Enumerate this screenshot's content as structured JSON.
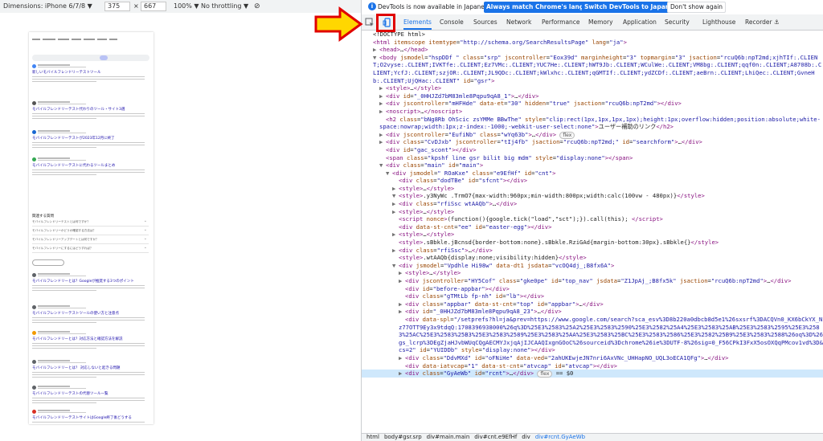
{
  "device_toolbar": {
    "dimensions_label": "Dimensions: iPhone 6/7/8 ▼",
    "width": "375",
    "times": "×",
    "height": "667",
    "zoom": "100% ▼",
    "throttle": "No throttling ▼"
  },
  "banner": {
    "message": "DevTools is now available in Japanese!",
    "match_button": "Always match Chrome's language",
    "switch_button": "Switch DevTools to Japanese",
    "dismiss_button": "Don't show again"
  },
  "tabs": [
    "Elements",
    "Console",
    "Sources",
    "Network",
    "Performance",
    "Memory",
    "Application",
    "Security",
    "Lighthouse",
    "Recorder ⚓"
  ],
  "phone": {
    "results": [
      {
        "title": "新しいモバイルフレンドリーテストツール",
        "fav": "#4285f4"
      },
      {
        "title": "モバイルフレンドリーテスト代わりのツール・サイト3選",
        "fav": "#555555"
      },
      {
        "title": "モバイルフレンドリーテストが2023年12月に終了",
        "fav": "#1967d2"
      },
      {
        "title": "モバイルフレンドリーテストに代わるツールまとめ",
        "fav": "#34a853"
      }
    ],
    "faq_heading": "関連する質問",
    "faq": [
      "モバイルフレンドリーテストとは何ですか？",
      "モバイルフレンドリーかどうか確認する方法は？",
      "モバイルフレンドリーアップデートとは何ですか？",
      "モバイルフレンドリーにするにはどうすれば？"
    ],
    "results2": [
      {
        "title": "モバイルフレンドリーとは？Googleが推奨する3つのポイント",
        "fav": "#5f6368"
      },
      {
        "title": "モバイルフレンドリーテストツールの使い方と注意点",
        "fav": "#5f6368"
      },
      {
        "title": "モバイルフレンドリーとは？対応方法と確認方法を解説",
        "fav": "#f29900"
      },
      {
        "title": "モバイルフレンドリーとは？ 対応しないと起きる問題",
        "fav": "#5f6368"
      },
      {
        "title": "モバイルフレンドリーテストの代替ツール一覧",
        "fav": "#5f6368"
      },
      {
        "title": "モバイルフレンドリーテストサイトはGoogle終了後どうする",
        "fav": "#d93025"
      }
    ]
  },
  "breadcrumbs": [
    "html",
    "body#gsr.srp",
    "div#main.main",
    "div#cnt.e9EfHf",
    "div",
    "div#rcnt.GyAeWb"
  ],
  "dom_lines": [
    {
      "indent": 0,
      "html": "<span class=\"tx\">&lt;!DOCTYPE html&gt;</span>"
    },
    {
      "indent": 0,
      "html": "<span class=\"tg\">&lt;html</span> <span class=\"at\">itemscope</span> <span class=\"at\">itemtype</span>=<span class=\"av\">\"http://schema.org/SearchResultsPage\"</span> <span class=\"at\">lang</span>=<span class=\"av\">\"ja\"</span><span class=\"tg\">&gt;</span>"
    },
    {
      "indent": 1,
      "tw": "▶",
      "html": "<span class=\"tg\">&lt;head&gt;</span>…<span class=\"tg\">&lt;/head&gt;</span>"
    },
    {
      "indent": 1,
      "tw": "▼",
      "wrap": true,
      "html": "<span class=\"tg\">&lt;body</span> <span class=\"at\">jsmodel</span>=<span class=\"av\">\"hspDDf \"</span> <span class=\"at\">class</span>=<span class=\"av\">\"srp\"</span> <span class=\"at\">jscontroller</span>=<span class=\"av\">\"Eox39d\"</span> <span class=\"at\">marginheight</span>=<span class=\"av\">\"3\"</span> <span class=\"at\">topmargin</span>=<span class=\"av\">\"3\"</span> <span class=\"at\">jsaction</span>=<span class=\"av\">\"rcuQ6b:npT2md;xjhTIf:.CLIENT;O2vyse:.CLIENT;IVKTfe:.CLIENT;Ez7VMc:.CLIENT;YUC7He:.CLIENT;hWT9Jb:.CLIENT;WCulWe:.CLIENT;VM8bg:.CLIENT;qqf0n:.CLIENT;A8708b:.CLIENT;YcfJ:.CLIENT;szjOR:.CLIENT;JL9QDc:.CLIENT;kWlxhc:.CLIENT;qGMTIf:.CLIENT;ydZCDf:.CLIENT;aeBrn:.CLIENT;LhiQec:.CLIENT;GvneHb:.CLIENT;UjQHac:.CLIENT\"</span> <span class=\"at\">id</span>=<span class=\"av\">\"gsr\"</span><span class=\"tg\">&gt;</span>"
    },
    {
      "indent": 2,
      "tw": "▶",
      "html": "<span class=\"tg\">&lt;style&gt;</span>…<span class=\"tg\">&lt;/style&gt;</span>"
    },
    {
      "indent": 2,
      "tw": "▶",
      "html": "<span class=\"tg\">&lt;div</span> <span class=\"at\">id</span>=<span class=\"av\">\"_0HHJZd7bM83mle8Pqpu9qA8_1\"</span><span class=\"tg\">&gt;</span>…<span class=\"tg\">&lt;/div&gt;</span>"
    },
    {
      "indent": 2,
      "tw": "▶",
      "html": "<span class=\"tg\">&lt;div</span> <span class=\"at\">jscontroller</span>=<span class=\"av\">\"mHFHde\"</span> <span class=\"at\">data-et</span>=<span class=\"av\">\"30\"</span> <span class=\"at\">hidden</span>=<span class=\"av\">\"true\"</span> <span class=\"at\">jsaction</span>=<span class=\"av\">\"rcuQ6b:npT2md\"</span><span class=\"tg\">&gt;&lt;/div&gt;</span>"
    },
    {
      "indent": 2,
      "tw": "▶",
      "html": "<span class=\"tg\">&lt;noscript&gt;</span>…<span class=\"tg\">&lt;/noscript&gt;</span>"
    },
    {
      "indent": 2,
      "wrap": true,
      "html": "<span class=\"tg\">&lt;h2</span> <span class=\"at\">class</span>=<span class=\"av\">\"bNg8Rb OhScic zsYMMe BBwThe\"</span> <span class=\"at\">style</span>=<span class=\"av\">\"clip:rect(1px,1px,1px,1px);height:1px;overflow:hidden;position:absolute;white-space:nowrap;width:1px;z-index:-1000;-webkit-user-select:none\"</span><span class=\"tg\">&gt;</span>ユーザー補助のリンク<span class=\"tg\">&lt;/h2&gt;</span>"
    },
    {
      "indent": 2,
      "tw": "▶",
      "html": "<span class=\"tg\">&lt;div</span> <span class=\"at\">jscontroller</span>=<span class=\"av\">\"EufiNb\"</span> <span class=\"at\">class</span>=<span class=\"av\">\"wYq63b\"</span><span class=\"tg\">&gt;</span>…<span class=\"tg\">&lt;/div&gt;</span> <span class=\"badge\">flex</span>"
    },
    {
      "indent": 2,
      "tw": "▶",
      "html": "<span class=\"tg\">&lt;div</span> <span class=\"at\">class</span>=<span class=\"av\">\"CvDJxb\"</span> <span class=\"at\">jscontroller</span>=<span class=\"av\">\"tIj4fb\"</span> <span class=\"at\">jsaction</span>=<span class=\"av\">\"rcuQ6b:npT2md;\"</span> <span class=\"at\">id</span>=<span class=\"av\">\"searchform\"</span><span class=\"tg\">&gt;</span>…<span class=\"tg\">&lt;/div&gt;</span>"
    },
    {
      "indent": 2,
      "html": "<span class=\"tg\">&lt;div</span> <span class=\"at\">id</span>=<span class=\"av\">\"gac_scont\"</span><span class=\"tg\">&gt;&lt;/div&gt;</span>"
    },
    {
      "indent": 2,
      "html": "<span class=\"tg\">&lt;span</span> <span class=\"at\">class</span>=<span class=\"av\">\"kpshf line gsr bilit big mdm\"</span> <span class=\"at\">style</span>=<span class=\"av\">\"display:none\"</span><span class=\"tg\">&gt;&lt;/span&gt;</span>"
    },
    {
      "indent": 2,
      "tw": "▼",
      "html": "<span class=\"tg\">&lt;div</span> <span class=\"at\">class</span>=<span class=\"av\">\"main\"</span> <span class=\"at\">id</span>=<span class=\"av\">\"main\"</span><span class=\"tg\">&gt;</span>"
    },
    {
      "indent": 3,
      "tw": "▼",
      "html": "<span class=\"tg\">&lt;div</span> <span class=\"at\">jsmodel</span>=<span class=\"av\">\" ROaKxe\"</span> <span class=\"at\">class</span>=<span class=\"av\">\"e9EfHf\"</span> <span class=\"at\">id</span>=<span class=\"av\">\"cnt\"</span><span class=\"tg\">&gt;</span>"
    },
    {
      "indent": 4,
      "html": "<span class=\"tg\">&lt;div</span> <span class=\"at\">class</span>=<span class=\"av\">\"dodTBe\"</span> <span class=\"at\">id</span>=<span class=\"av\">\"sfcnt\"</span><span class=\"tg\">&gt;&lt;/div&gt;</span>"
    },
    {
      "indent": 4,
      "tw": "▶",
      "html": "<span class=\"tg\">&lt;style&gt;</span>…<span class=\"tg\">&lt;/style&gt;</span>"
    },
    {
      "indent": 4,
      "tw": "▼",
      "html": "<span class=\"tg\">&lt;style&gt;</span>.y3NyWc .TrmO7{max-width:960px;min-width:800px;width:calc(100vw - 480px)}<span class=\"tg\">&lt;/style&gt;</span>"
    },
    {
      "indent": 4,
      "tw": "▶",
      "html": "<span class=\"tg\">&lt;div</span> <span class=\"at\">class</span>=<span class=\"av\">\"rfiSsc wtAAQb\"</span><span class=\"tg\">&gt;</span>…<span class=\"tg\">&lt;/div&gt;</span>"
    },
    {
      "indent": 4,
      "tw": "▶",
      "html": "<span class=\"tg\">&lt;style&gt;</span>…<span class=\"tg\">&lt;/style&gt;</span>"
    },
    {
      "indent": 4,
      "html": "<span class=\"tg\">&lt;script</span> <span class=\"at\">nonce</span><span class=\"tg\">&gt;</span>(function(){google.tick(\"load\",\"sct\");}).call(this); <span class=\"tg\">&lt;/script&gt;</span>"
    },
    {
      "indent": 4,
      "html": "<span class=\"tg\">&lt;div</span> <span class=\"at\">data-st-cnt</span>=<span class=\"av\">\"ee\"</span> <span class=\"at\">id</span>=<span class=\"av\">\"easter-egg\"</span><span class=\"tg\">&gt;&lt;/div&gt;</span>"
    },
    {
      "indent": 4,
      "tw": "▶",
      "html": "<span class=\"tg\">&lt;style&gt;</span>…<span class=\"tg\">&lt;/style&gt;</span>"
    },
    {
      "indent": 4,
      "html": "<span class=\"tg\">&lt;style&gt;</span>.sBbkle.jBcnsd{border-bottom:none}.sBbkle.RziGAd{margin-bottom:30px}.sBbkle{}<span class=\"tg\">&lt;/style&gt;</span>"
    },
    {
      "indent": 4,
      "tw": "▶",
      "html": "<span class=\"tg\">&lt;div</span> <span class=\"at\">class</span>=<span class=\"av\">\"rfiSsc\"</span><span class=\"tg\">&gt;</span>…<span class=\"tg\">&lt;/div&gt;</span>"
    },
    {
      "indent": 4,
      "html": "<span class=\"tg\">&lt;style&gt;</span>.wtAAQb{display:none;visibility:hidden}<span class=\"tg\">&lt;/style&gt;</span>"
    },
    {
      "indent": 4,
      "tw": "▼",
      "html": "<span class=\"tg\">&lt;div</span> <span class=\"at\">jsmodel</span>=<span class=\"av\">\"Vpdhle Hi98w\"</span> <span class=\"at\">data-dt1</span> <span class=\"at\">jsdata</span>=<span class=\"av\">\"vcOQ4dj_;B8fx6A\"</span><span class=\"tg\">&gt;</span>"
    },
    {
      "indent": 5,
      "tw": "▶",
      "html": "<span class=\"tg\">&lt;style&gt;</span>…<span class=\"tg\">&lt;/style&gt;</span>"
    },
    {
      "indent": 5,
      "tw": "▶",
      "html": "<span class=\"tg\">&lt;div</span> <span class=\"at\">jscontroller</span>=<span class=\"av\">\"HY5Cof\"</span> <span class=\"at\">class</span>=<span class=\"av\">\"gke0pe\"</span> <span class=\"at\">id</span>=<span class=\"av\">\"top_nav\"</span> <span class=\"at\">jsdata</span>=<span class=\"av\">\"Z1JpAj_;B8fx5k\"</span> <span class=\"at\">jsaction</span>=<span class=\"av\">\"rcuQ6b:npT2md\"</span><span class=\"tg\">&gt;</span>…<span class=\"tg\">&lt;/div&gt;</span>"
    },
    {
      "indent": 5,
      "html": "<span class=\"tg\">&lt;div</span> <span class=\"at\">id</span>=<span class=\"av\">\"before-appbar\"</span><span class=\"tg\">&gt;&lt;/div&gt;</span>"
    },
    {
      "indent": 5,
      "html": "<span class=\"tg\">&lt;div</span> <span class=\"at\">class</span>=<span class=\"av\">\"gTMtLb fp-nh\"</span> <span class=\"at\">id</span>=<span class=\"av\">\"lb\"</span><span class=\"tg\">&gt;&lt;/div&gt;</span>"
    },
    {
      "indent": 5,
      "tw": "▶",
      "html": "<span class=\"tg\">&lt;div</span> <span class=\"at\">class</span>=<span class=\"av\">\"appbar\"</span> <span class=\"at\">data-st-cnt</span>=<span class=\"av\">\"top\"</span> <span class=\"at\">id</span>=<span class=\"av\">\"appbar\"</span><span class=\"tg\">&gt;</span>…<span class=\"tg\">&lt;/div&gt;</span>"
    },
    {
      "indent": 5,
      "tw": "▶",
      "html": "<span class=\"tg\">&lt;div</span> <span class=\"at\">id</span>=<span class=\"av\">\"_0HHJZd7bM83mle8Pqpu9qA8_23\"</span><span class=\"tg\">&gt;</span>…<span class=\"tg\">&lt;/div&gt;</span>"
    },
    {
      "indent": 5,
      "wrap": true,
      "html": "<span class=\"tg\">&lt;div</span> <span class=\"at\">data-spl</span>=<span class=\"av\">\"/setprefs?hl=ja&amp;prev=https://www.google.com/search?sca_esv%3D8b220a0dbcb8d5e1%26sxsrf%3DACQVn0_KX6bCkYX_Nz77OTT9Ey3x9tdqQ:1708396938000%26q%3D%25E3%2583%25A2%25E3%2583%2590%25E3%2582%25A4%25E3%2583%25AB%25E3%2583%2595%25E3%2583%25AC%25E3%2583%25B3%25E3%2583%2589%25E3%2583%25AA%25E3%2583%25BC%25E3%2583%2586%25E3%2582%25B9%25E3%2583%2588%26oq%3D%26gs_lcrp%3DEgZjaHJvbWUqCQgAECMYJxjqAjIJCAAQIxgnGOoC%26sourceid%3Dchrome%26ie%3DUTF-8%26sig=0_F56CPkI3FxX5osOXQqPMcov1vd%3D&amp;cs=2\"</span> <span class=\"at\">id</span>=<span class=\"av\">\"YUIDDb\"</span> <span class=\"at\">style</span>=<span class=\"av\">\"display:none\"</span><span class=\"tg\">&gt;&lt;/div&gt;</span>"
    },
    {
      "indent": 5,
      "tw": "▶",
      "html": "<span class=\"tg\">&lt;div</span> <span class=\"at\">class</span>=<span class=\"av\">\"DdvMXd\"</span> <span class=\"at\">id</span>=<span class=\"av\">\"oFNiHe\"</span> <span class=\"at\">data-ved</span>=<span class=\"av\">\"2ahUKEwjeJN7nri6AxVNc_UHHapNO_UQL3oECA1QFg\"</span><span class=\"tg\">&gt;</span>…<span class=\"tg\">&lt;/div&gt;</span>"
    },
    {
      "indent": 5,
      "html": "<span class=\"tg\">&lt;div</span> <span class=\"at\">data-iatvcap</span>=<span class=\"av\">\"1\"</span> <span class=\"at\">data-st-cnt</span>=<span class=\"av\">\"atvcap\"</span> <span class=\"at\">id</span>=<span class=\"av\">\"atvcap\"</span><span class=\"tg\">&gt;&lt;/div&gt;</span>"
    },
    {
      "indent": 5,
      "tw": "▶",
      "selected": true,
      "html": "<span class=\"tg\">&lt;div</span> <span class=\"at\">class</span>=<span class=\"av\">\"GyAeWb\"</span> <span class=\"at\">id</span>=<span class=\"av\">\"rcnt\"</span><span class=\"tg\">&gt;</span>…<span class=\"tg\">&lt;/div&gt;</span> <span class=\"badge\">flex</span> == $0"
    }
  ]
}
